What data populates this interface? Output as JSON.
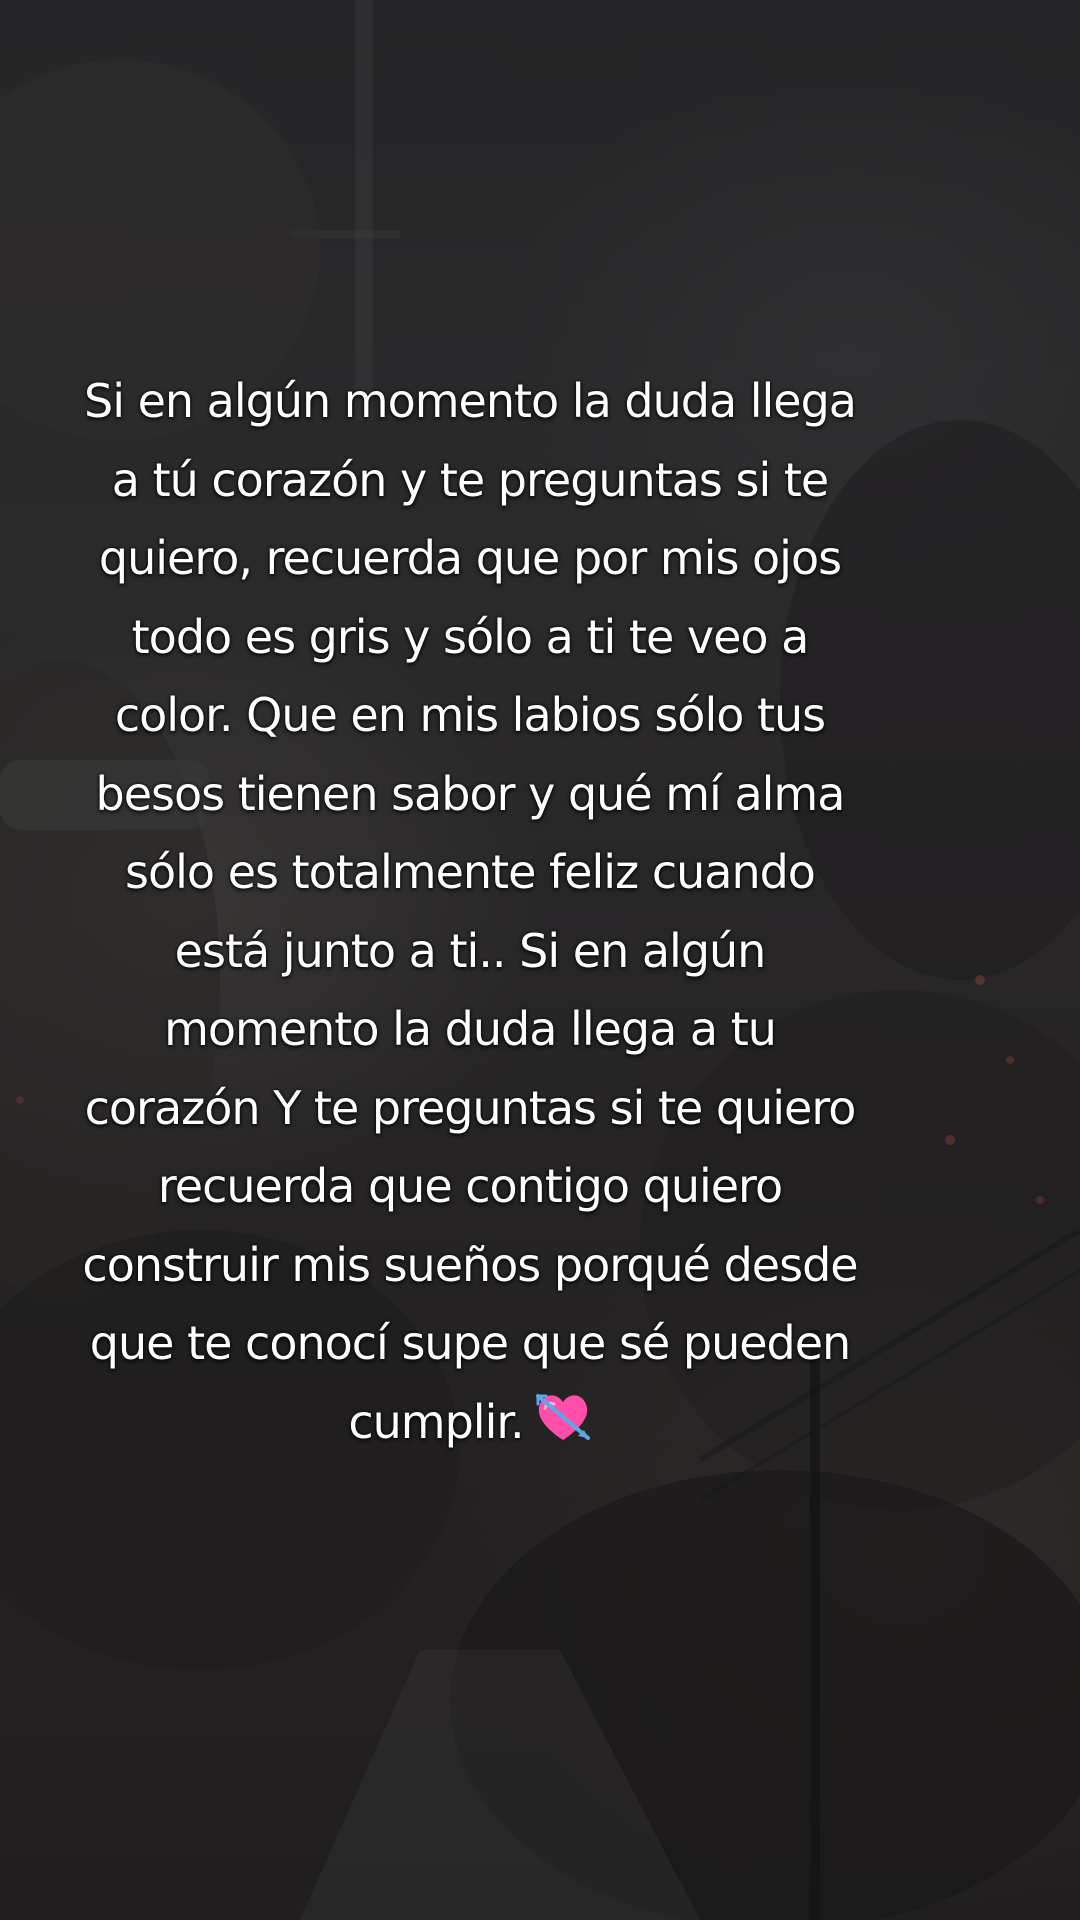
{
  "caption": {
    "text": "Si en algún momento la duda llega\na tú corazón y te preguntas si te\nquiero, recuerda que por mis ojos\ntodo es gris y sólo a ti te veo a\ncolor. Que en mis labios sólo tus\nbesos tienen sabor y qué mí alma\nsólo es totalmente feliz cuando\nestá junto a ti.. Si en algún\nmomento la duda llega a tu\ncorazón Y te preguntas si te quiero\nrecuerda que contigo quiero\nconstruir mis sueños porqué desde\nque te conocí supe que sé pueden\ncumplir.",
    "emoji": "heart-with-arrow-icon"
  },
  "colors": {
    "text": "#ffffff",
    "background": "#262425",
    "heart": "#ff4fa8",
    "arrow": "#5aa9e6"
  }
}
